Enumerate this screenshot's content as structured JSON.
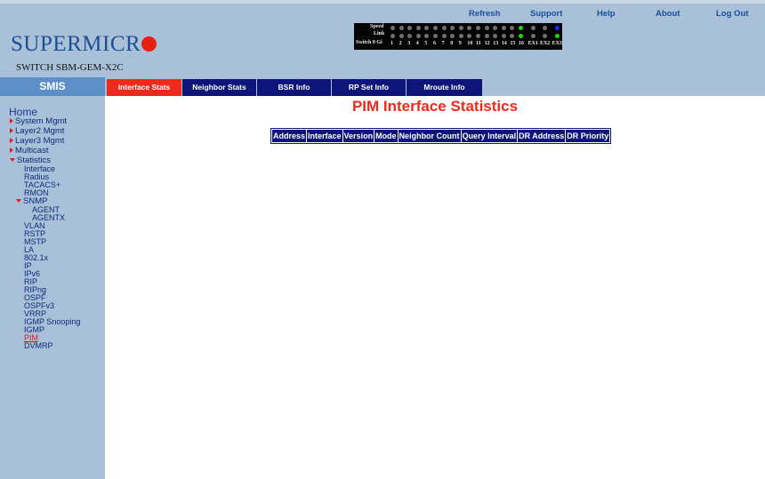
{
  "header": {
    "logo_text": "SUPERMICR",
    "model": "SWITCH SBM-GEM-X2C",
    "links": [
      {
        "label": "Refresh"
      },
      {
        "label": "Support"
      },
      {
        "label": "Help"
      },
      {
        "label": "About"
      },
      {
        "label": "Log Out"
      }
    ]
  },
  "leds": {
    "speed_label": "Speed",
    "link_label": "Link",
    "switch_label": "Switch 0 Gi",
    "ports": [
      "1",
      "2",
      "3",
      "4",
      "5",
      "6",
      "7",
      "8",
      "9",
      "10",
      "11",
      "12",
      "13",
      "14",
      "15",
      "16",
      "EX1",
      "EX2",
      "EX3"
    ],
    "colors": {
      "off": "#707070",
      "green": "#18d818",
      "blue": "#1a2aff"
    }
  },
  "nav": {
    "smis": "SMIS",
    "tabs": [
      {
        "label": "Interface Stats",
        "active": true
      },
      {
        "label": "Neighbor Stats"
      },
      {
        "label": "BSR Info"
      },
      {
        "label": "RP Set Info"
      },
      {
        "label": "Mroute Info"
      }
    ]
  },
  "sidebar": {
    "home": "Home",
    "system_mgmt": "System Mgmt",
    "layer2_mgmt": "Layer2 Mgmt",
    "layer3_mgmt": "Layer3 Mgmt",
    "multicast": "Multicast",
    "statistics": "Statistics",
    "interface": "Interface",
    "radius": "Radius",
    "tacacs": "TACACS+",
    "rmon": "RMON",
    "snmp": "SNMP",
    "agent": "AGENT",
    "agentx": "AGENTX",
    "vlan": "VLAN",
    "rstp": "RSTP",
    "mstp": "MSTP",
    "la": "LA",
    "dot1x": "802.1x",
    "ip": "IP",
    "ipv6": "IPv6",
    "rip": "RIP",
    "ripng": "RIPng",
    "ospf": "OSPF",
    "ospfv3": "OSPFv3",
    "vrrp": "VRRP",
    "igmp_snooping": "IGMP Snooping",
    "igmp": "IGMP",
    "pim": "PIM",
    "dvmrp": "DVMRP"
  },
  "main": {
    "title": "PIM Interface Statistics",
    "columns": [
      "Address",
      "Interface",
      "Version",
      "Mode",
      "Neighbor Count",
      "Query Interval",
      "DR Address",
      "DR Priority"
    ]
  },
  "colors": {
    "accent_red": "#ee2a1c",
    "tab_navy": "#0e1578",
    "panel_blue": "#a9c1d8",
    "smis_blue": "#5c8ec7"
  }
}
